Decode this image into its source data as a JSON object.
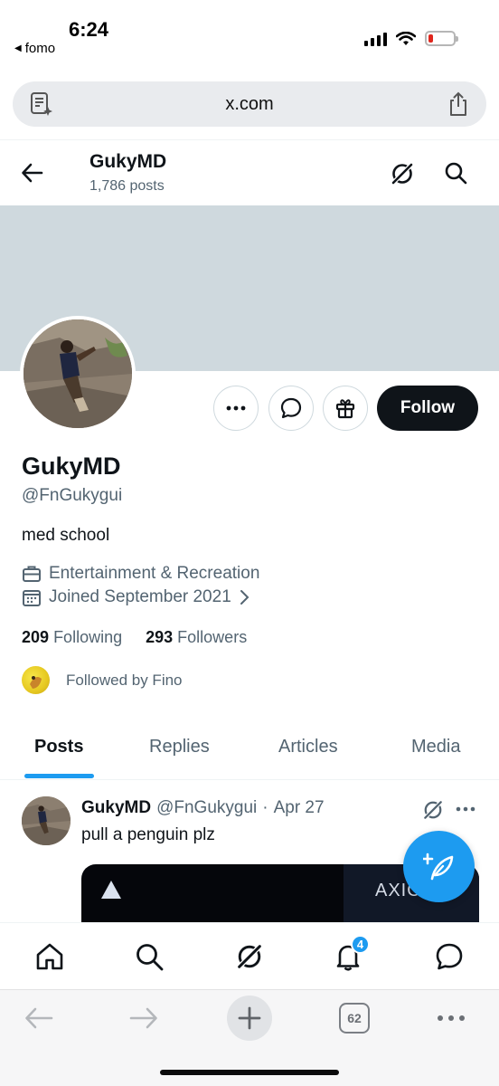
{
  "status_bar": {
    "time": "6:24",
    "back_app": "fomo"
  },
  "browser": {
    "url": "x.com",
    "tabs_count": "62"
  },
  "header": {
    "name": "GukyMD",
    "posts_count": "1,786 posts"
  },
  "actions": {
    "follow_label": "Follow"
  },
  "profile": {
    "display_name": "GukyMD",
    "handle": "@FnGukygui",
    "bio": "med school",
    "category": "Entertainment & Recreation",
    "joined": "Joined September 2021",
    "following_count": "209",
    "following_label": "Following",
    "followers_count": "293",
    "followers_label": "Followers",
    "followed_by": "Followed by Fino"
  },
  "tabs": [
    {
      "label": "Posts",
      "active": true
    },
    {
      "label": "Replies",
      "active": false
    },
    {
      "label": "Articles",
      "active": false
    },
    {
      "label": "Media",
      "active": false
    }
  ],
  "post": {
    "name": "GukyMD",
    "handle": "@FnGukygui",
    "separator": "·",
    "date": "Apr 27",
    "text": "pull a penguin plz",
    "media_text": "AXIOM"
  },
  "bottom_nav": {
    "notifications_badge": "4"
  },
  "colors": {
    "accent": "#1d9bf0",
    "follow_bg": "#0f1419",
    "banner": "#cfd9de"
  },
  "icons": [
    "back-arrow-icon",
    "grok-icon",
    "search-icon",
    "more-icon",
    "chat-icon",
    "gift-icon",
    "briefcase-icon",
    "calendar-icon",
    "home-icon",
    "bell-icon",
    "messages-icon",
    "compose-icon",
    "share-icon",
    "reader-icon"
  ]
}
